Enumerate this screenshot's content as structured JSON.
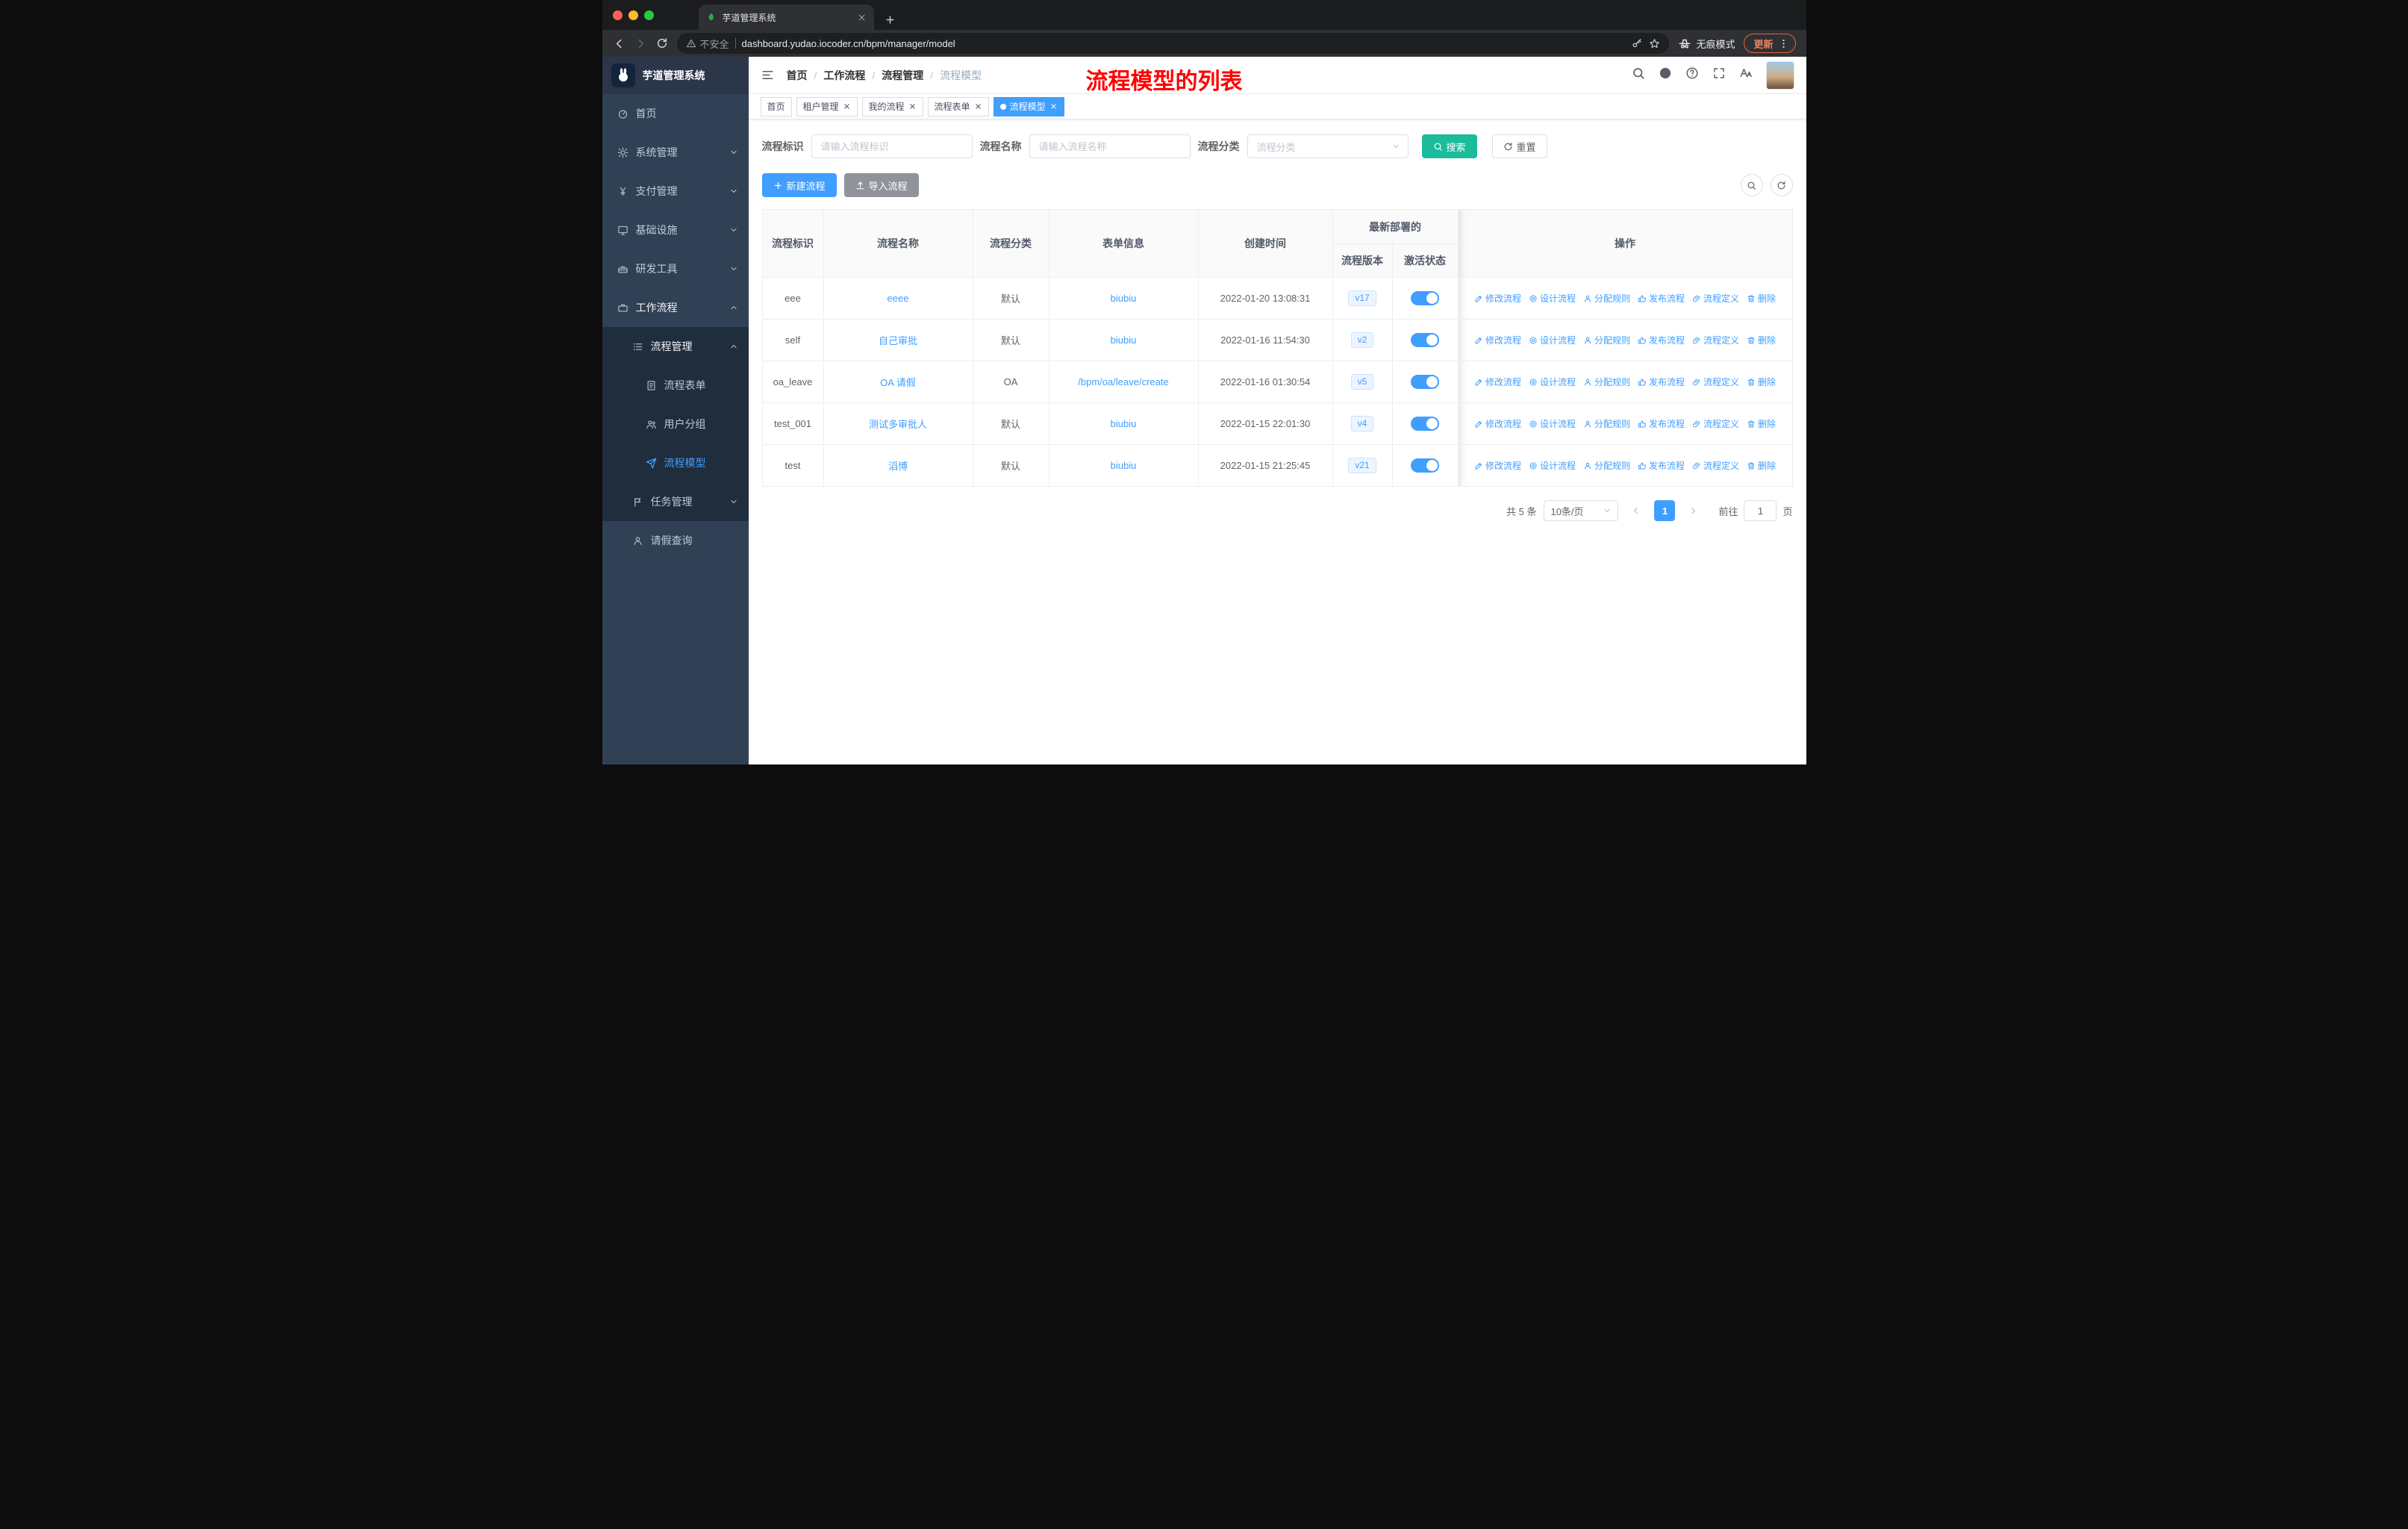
{
  "browser": {
    "tab_title": "芋道管理系统",
    "security_label": "不安全",
    "url": "dashboard.yudao.iocoder.cn/bpm/manager/model",
    "incognito_label": "无痕模式",
    "update_label": "更新"
  },
  "sidebar": {
    "app_title": "芋道管理系统",
    "items": [
      {
        "label": "首页",
        "icon": "dashboard-icon",
        "level": 1
      },
      {
        "label": "系统管理",
        "icon": "gear-icon",
        "level": 1,
        "chevron": "down"
      },
      {
        "label": "支付管理",
        "icon": "yen-icon",
        "level": 1,
        "chevron": "down"
      },
      {
        "label": "基础设施",
        "icon": "infrastructure-icon",
        "level": 1,
        "chevron": "down"
      },
      {
        "label": "研发工具",
        "icon": "tools-icon",
        "level": 1,
        "chevron": "down"
      },
      {
        "label": "工作流程",
        "icon": "briefcase-icon",
        "level": 1,
        "chevron": "up",
        "open": true
      },
      {
        "label": "流程管理",
        "icon": "list-icon",
        "level": 2,
        "chevron": "up",
        "sub": true,
        "open": true
      },
      {
        "label": "流程表单",
        "icon": "document-icon",
        "level": 3,
        "sub": true
      },
      {
        "label": "用户分组",
        "icon": "users-icon",
        "level": 3,
        "sub": true
      },
      {
        "label": "流程模型",
        "icon": "paper-plane-icon",
        "level": 3,
        "sub": true,
        "active": true
      },
      {
        "label": "任务管理",
        "icon": "flag-icon",
        "level": 2,
        "chevron": "down",
        "sub": true
      },
      {
        "label": "请假查询",
        "icon": "person-icon",
        "level": 2
      }
    ]
  },
  "topbar": {
    "breadcrumb": [
      "首页",
      "工作流程",
      "流程管理",
      "流程模型"
    ],
    "annotation": "流程模型的列表"
  },
  "tags": [
    {
      "label": "首页",
      "closable": false,
      "active": false
    },
    {
      "label": "租户管理",
      "closable": true,
      "active": false
    },
    {
      "label": "我的流程",
      "closable": true,
      "active": false
    },
    {
      "label": "流程表单",
      "closable": true,
      "active": false
    },
    {
      "label": "流程模型",
      "closable": true,
      "active": true
    }
  ],
  "filters": {
    "key_label": "流程标识",
    "key_placeholder": "请输入流程标识",
    "name_label": "流程名称",
    "name_placeholder": "请输入流程名称",
    "category_label": "流程分类",
    "category_placeholder": "流程分类",
    "search_label": "搜索",
    "reset_label": "重置"
  },
  "toolbar": {
    "create_label": "新建流程",
    "import_label": "导入流程"
  },
  "table": {
    "columns": [
      "流程标识",
      "流程名称",
      "流程分类",
      "表单信息",
      "创建时间"
    ],
    "group": {
      "label": "最新部署的",
      "children": [
        "流程版本",
        "激活状态"
      ]
    },
    "actions_column": "操作",
    "actions": [
      {
        "name": "modify",
        "label": "修改流程",
        "icon": "edit-icon"
      },
      {
        "name": "design",
        "label": "设计流程",
        "icon": "design-icon"
      },
      {
        "name": "assign-rule",
        "label": "分配规则",
        "icon": "user-icon"
      },
      {
        "name": "publish",
        "label": "发布流程",
        "icon": "publish-icon"
      },
      {
        "name": "definition",
        "label": "流程定义",
        "icon": "link-icon"
      },
      {
        "name": "delete",
        "label": "删除",
        "icon": "trash-icon"
      }
    ],
    "rows": [
      {
        "key": "eee",
        "name": "eeee",
        "category": "默认",
        "form": "biubiu",
        "created": "2022-01-20 13:08:31",
        "version": "v17",
        "active": true
      },
      {
        "key": "self",
        "name": "自己审批",
        "category": "默认",
        "form": "biubiu",
        "created": "2022-01-16 11:54:30",
        "version": "v2",
        "active": true
      },
      {
        "key": "oa_leave",
        "name": "OA 请假",
        "category": "OA",
        "form": "/bpm/oa/leave/create",
        "created": "2022-01-16 01:30:54",
        "version": "v5",
        "active": true
      },
      {
        "key": "test_001",
        "name": "测试多审批人",
        "category": "默认",
        "form": "biubiu",
        "created": "2022-01-15 22:01:30",
        "version": "v4",
        "active": true
      },
      {
        "key": "test",
        "name": "滔博",
        "category": "默认",
        "form": "biubiu",
        "created": "2022-01-15 21:25:45",
        "version": "v21",
        "active": true
      }
    ]
  },
  "pagination": {
    "total": "共 5 条",
    "page_size": "10条/页",
    "current_page": "1",
    "goto_label": "前往",
    "goto_value": "1",
    "page_unit": "页"
  },
  "colors": {
    "accent": "#409EFF",
    "search_button": "#1ABC9C",
    "sidebar_bg": "#304156",
    "sidebar_sub_bg": "#1F2D3D",
    "annotation": "#FF0000"
  }
}
